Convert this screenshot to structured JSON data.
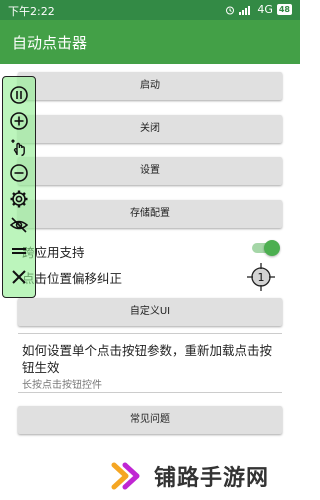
{
  "status_bar": {
    "time": "下午2:22",
    "network": "4G",
    "battery": "48",
    "icons": [
      "alarm-icon",
      "signal-icon",
      "battery-icon"
    ]
  },
  "app": {
    "title": "自动点击器",
    "colors": {
      "primary": "#43a047",
      "status_bar": "#338a45",
      "accent": "#4caf50"
    }
  },
  "buttons": {
    "start": "启动",
    "close": "关闭",
    "settings": "设置",
    "save_config": "存储配置",
    "custom_ui": "自定义UI",
    "faq": "常见问题"
  },
  "options": {
    "cross_app_support": "跨应用支持",
    "cross_app_enabled": true,
    "click_offset_correction": "点击位置偏移纠正",
    "target_marker": "1"
  },
  "help": {
    "title": "如何设置单个点击按钮参数，重新加载点击按钮生效",
    "subtitle": "长按点击按钮控件"
  },
  "floating_toolbar": {
    "icons": [
      "pause-icon",
      "add-icon",
      "swipe-icon",
      "remove-icon",
      "gear-icon",
      "hide-icon",
      "menu-icon",
      "close-icon"
    ]
  },
  "watermark": {
    "text": "铺路手游网"
  }
}
